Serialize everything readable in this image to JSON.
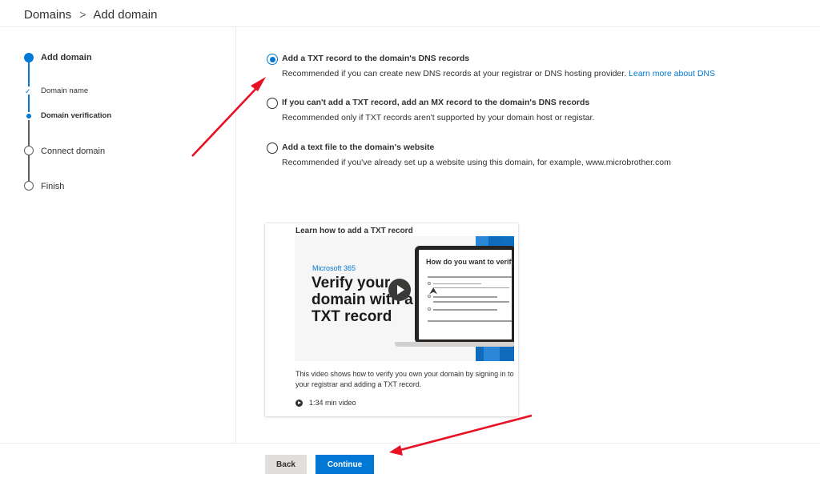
{
  "breadcrumb": {
    "parent": "Domains",
    "separator": ">",
    "current": "Add domain"
  },
  "stepper": {
    "main_step": "Add domain",
    "substeps": [
      "Domain name",
      "Domain verification"
    ],
    "steps": [
      "Connect domain",
      "Finish"
    ]
  },
  "options": [
    {
      "title": "Add a TXT record to the domain's DNS records",
      "description": "Recommended if you can create new DNS records at your registrar or DNS hosting provider.",
      "link": "Learn more about DNS",
      "selected": true
    },
    {
      "title": "If you can't add a TXT record, add an MX record to the domain's DNS records",
      "description": "Recommended only if TXT records aren't supported by your domain host or registar.",
      "selected": false
    },
    {
      "title": "Add a text file to the domain's website",
      "description": "Recommended if you've already set up a website using this domain, for example, www.microbrother.com",
      "selected": false
    }
  ],
  "video": {
    "title": "Learn how to add a TXT record",
    "brand": "Microsoft 365",
    "headline": "Verify your domain with a TXT record",
    "screen_title": "How do you want to verify",
    "description": "This video shows how to verify you own your domain by signing in to your registrar and adding a TXT record.",
    "duration": "1:34 min video"
  },
  "buttons": {
    "back": "Back",
    "continue": "Continue"
  },
  "colors": {
    "accent": "#0078d4",
    "annotation": "#e81123"
  }
}
